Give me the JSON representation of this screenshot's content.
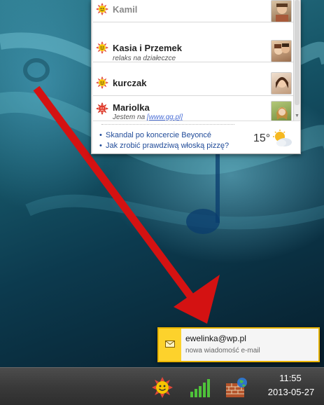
{
  "contacts": [
    {
      "name": "Kamil",
      "description": "",
      "status": "away",
      "avatar_icon": "child-photo"
    },
    {
      "name": "Kasia i Przemek",
      "description": "relaks na działeczce",
      "status": "available",
      "avatar_icon": "couple-photo"
    },
    {
      "name": "kurczak",
      "description": "",
      "status": "available",
      "avatar_icon": "woman-photo"
    },
    {
      "name": "Mariolka",
      "description_prefix": "Jestem na ",
      "description_link": "[www.gg.pl]",
      "status": "busy",
      "avatar_icon": "girl-photo"
    }
  ],
  "news": {
    "items": [
      "Skandal po koncercie Beyoncé",
      "Jak zrobić prawdziwą włoską pizzę?"
    ],
    "temperature": "15°",
    "weather_icon": "partly-cloudy-icon"
  },
  "notification": {
    "from": "ewelinka@wp.pl",
    "message": "nowa wiadomość e-mail",
    "icon": "envelope-icon",
    "accent": "#fdd22c"
  },
  "taskbar": {
    "time": "11:55",
    "date": "2013-05-27",
    "tray_icons": [
      "gg-sun-icon",
      "signal-strength-icon",
      "firewall-globe-icon"
    ]
  },
  "colors": {
    "arrow": "#d41212",
    "status_available": "#f2c400",
    "status_busy": "#d42a1a",
    "link": "#4a6ed6"
  }
}
